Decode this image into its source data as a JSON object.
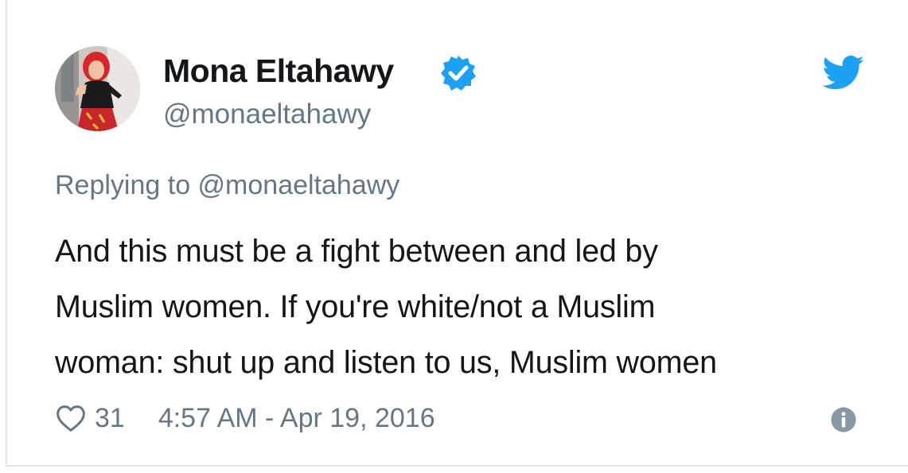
{
  "author": {
    "name": "Mona Eltahawy",
    "handle": "@monaeltahawy",
    "verified": true
  },
  "reply": {
    "label": "Replying to @monaeltahawy"
  },
  "tweet": {
    "lines": [
      "And this must be a fight between and led by",
      "Muslim women. If you're white/not a Muslim",
      "woman: shut up and listen to us, Muslim women"
    ]
  },
  "footer": {
    "like_count": "31",
    "timestamp": "4:57 AM - Apr 19, 2016"
  },
  "icons": {
    "verified": "verified-badge-icon",
    "brand": "twitter-bird-icon",
    "like": "heart-icon",
    "info": "info-icon"
  },
  "colors": {
    "brand_blue": "#1da1f2",
    "muted_text": "#657786",
    "body_text": "#14171a"
  }
}
